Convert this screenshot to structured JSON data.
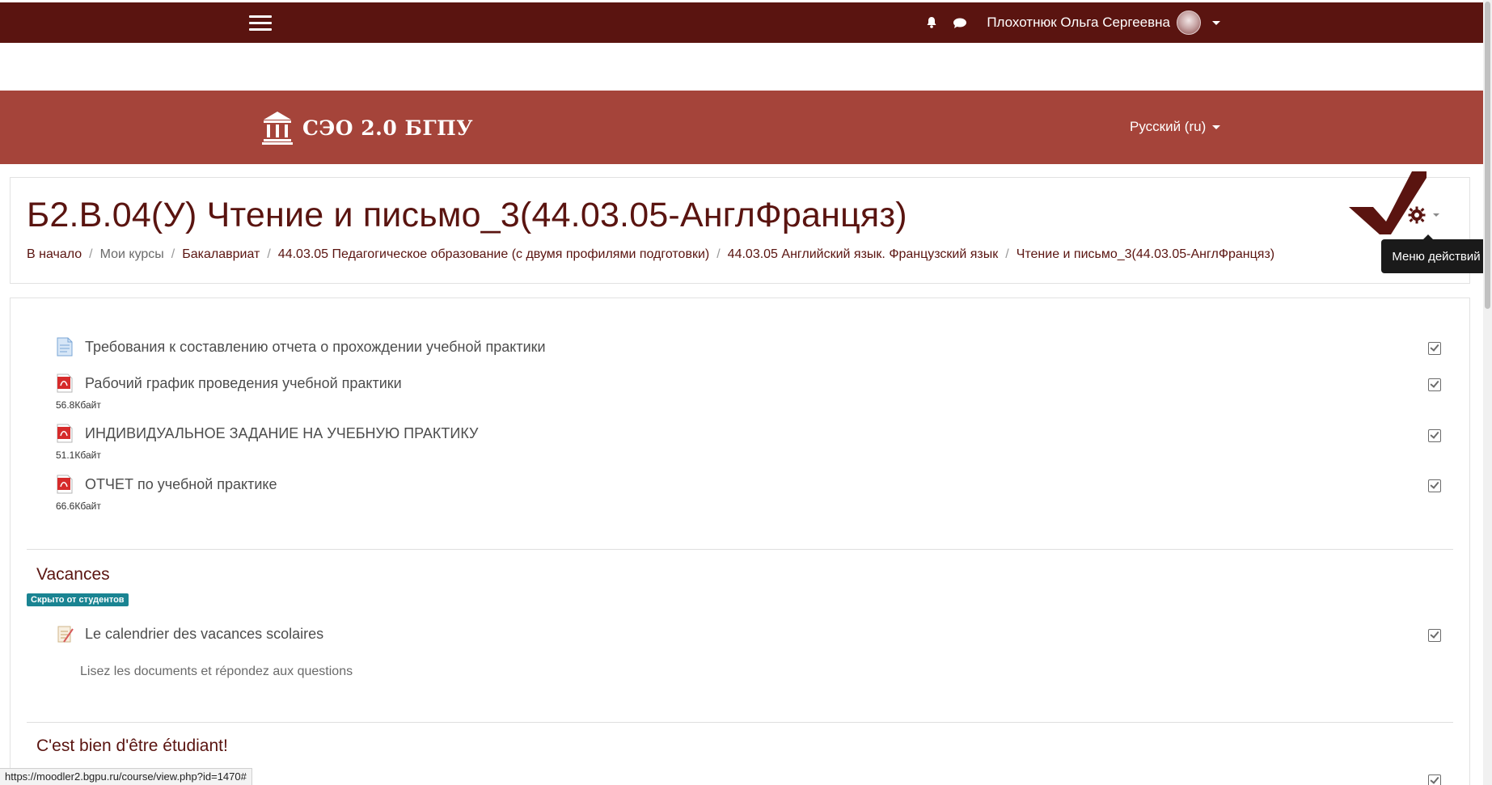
{
  "topbar": {
    "user_name": "Плохотнюк Ольга Сергеевна"
  },
  "brand": {
    "title": "СЭО 2.0 БГПУ",
    "language": "Русский (ru)"
  },
  "page": {
    "title": "Б2.В.04(У) Чтение и письмо_3(44.03.05-АнглФранцяз)",
    "breadcrumb": [
      "В начало",
      "Мои курсы",
      "Бакалавриат",
      "44.03.05 Педагогическое образование (с двумя профилями подготовки)",
      "44.03.05 Английский язык. Французский язык",
      "Чтение и письмо_3(44.03.05-АнглФранцяз)"
    ],
    "actions_tooltip": "Меню действий"
  },
  "activities": [
    {
      "title": "Требования к составлению отчета о прохождении учебной практики",
      "size": "",
      "icon": "page-icon"
    },
    {
      "title": "Рабочий график проведения учебной практики",
      "size": "56.8Кбайт",
      "icon": "pdf-icon"
    },
    {
      "title": "ИНДИВИДУАЛЬНОЕ ЗАДАНИЕ НА УЧЕБНУЮ ПРАКТИКУ",
      "size": "51.1Кбайт",
      "icon": "pdf-icon"
    },
    {
      "title": "ОТЧЕТ по учебной практике",
      "size": "66.6Кбайт",
      "icon": "pdf-icon"
    }
  ],
  "section_vacances": {
    "title": "Vacances",
    "badge": "Скрыто от студентов",
    "activity": "Le calendrier des vacances scolaires",
    "description": "Lisez les documents et répondez aux questions"
  },
  "section_etudiant": {
    "title": "C'est bien d'être étudiant!"
  },
  "status_url": "https://moodler2.bgpu.ru/course/view.php?id=1470#",
  "colors": {
    "topbar": "#5a1410",
    "brandbar": "#a5443a",
    "badge": "#1a8492"
  }
}
